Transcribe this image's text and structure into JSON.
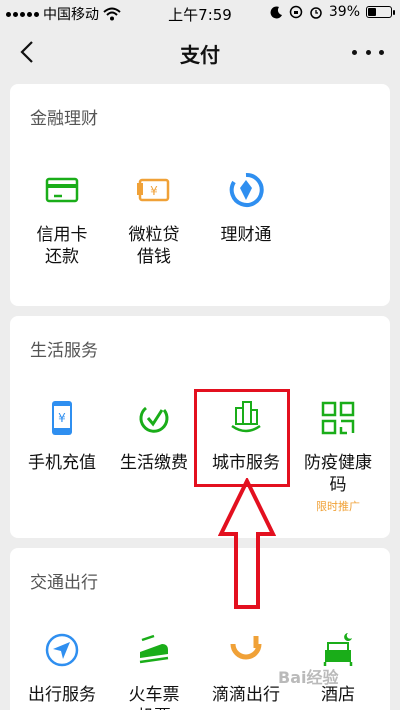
{
  "status": {
    "carrier": "中国移动",
    "time": "上午7:59",
    "battery": "39%",
    "battery_level": 0.39
  },
  "nav": {
    "title": "支付"
  },
  "sections": {
    "finance": {
      "title": "金融理财",
      "items": [
        {
          "label": "信用卡\n还款",
          "icon": "credit-card-icon"
        },
        {
          "label": "微粒贷\n借钱",
          "icon": "loan-icon"
        },
        {
          "label": "理财通",
          "icon": "wealth-icon"
        }
      ]
    },
    "life": {
      "title": "生活服务",
      "items": [
        {
          "label": "手机充值",
          "icon": "phone-topup-icon"
        },
        {
          "label": "生活缴费",
          "icon": "utility-bill-icon"
        },
        {
          "label": "城市服务",
          "icon": "city-service-icon"
        },
        {
          "label": "防疫健康\n码",
          "icon": "qr-code-icon",
          "tag": "限时推广"
        }
      ]
    },
    "transport": {
      "title": "交通出行",
      "items": [
        {
          "label": "出行服务",
          "icon": "navigation-icon"
        },
        {
          "label": "火车票\n机票",
          "icon": "train-icon"
        },
        {
          "label": "滴滴出行",
          "icon": "didi-icon"
        },
        {
          "label": "酒店",
          "icon": "hotel-icon"
        }
      ]
    }
  },
  "colors": {
    "green": "#1aad19",
    "orange": "#f0a137",
    "blue": "#2f8ff0",
    "highlight": "#e3101f"
  },
  "watermark": "Bai经验"
}
